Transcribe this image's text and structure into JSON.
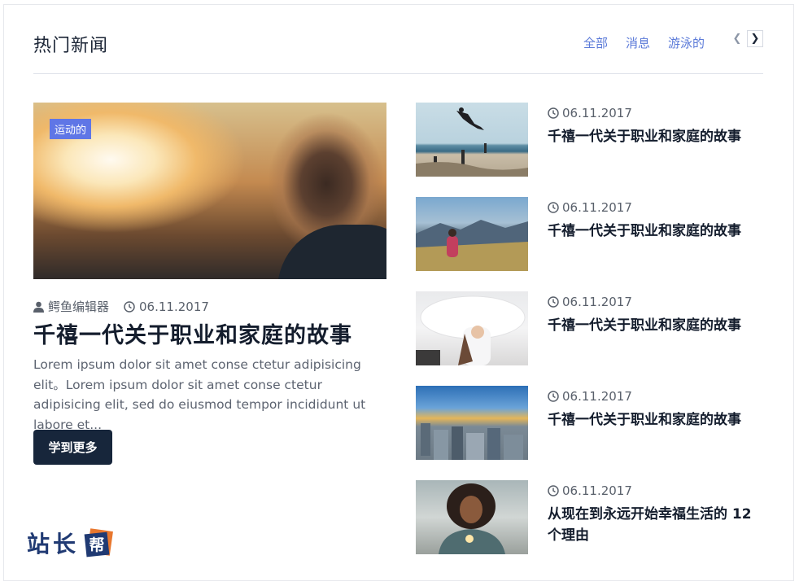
{
  "header": {
    "title": "热门新闻",
    "tabs": [
      "全部",
      "消息",
      "游泳的"
    ]
  },
  "feature": {
    "badge": "运动的",
    "author": "鳄鱼编辑器",
    "date": "06.11.2017",
    "title": "千禧一代关于职业和家庭的故事",
    "excerpt": "Lorem ipsum dolor sit amet conse ctetur adipisicing elit。Lorem ipsum dolor sit amet conse ctetur adipisicing elit, sed do eiusmod tempor incididunt ut labore et...",
    "button_label": "学到更多"
  },
  "side_items": [
    {
      "date": "06.11.2017",
      "title": "千禧一代关于职业和家庭的故事"
    },
    {
      "date": "06.11.2017",
      "title": "千禧一代关于职业和家庭的故事"
    },
    {
      "date": "06.11.2017",
      "title": "千禧一代关于职业和家庭的故事"
    },
    {
      "date": "06.11.2017",
      "title": "千禧一代关于职业和家庭的故事"
    },
    {
      "date": "06.11.2017",
      "title": "从现在到永远开始幸福生活的 12 个理由"
    }
  ],
  "logo": {
    "text": "站长",
    "mark": "帮"
  },
  "colors": {
    "accent": "#5f76e6",
    "button": "#17263b",
    "tab": "#5b7ad8"
  }
}
